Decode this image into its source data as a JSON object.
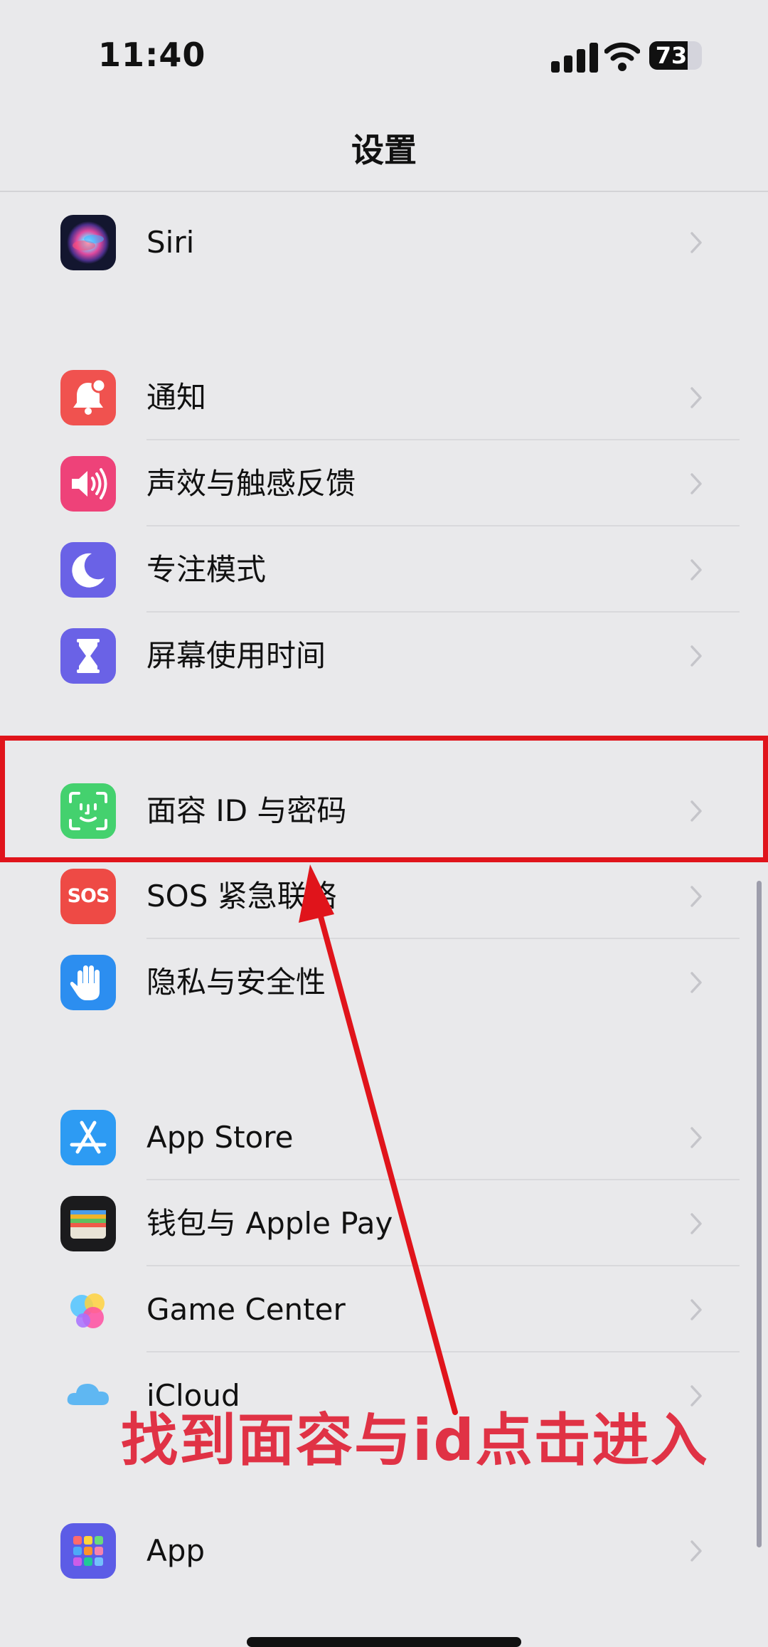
{
  "status_bar": {
    "time": "11:40",
    "battery_level": "73"
  },
  "nav": {
    "title": "设置"
  },
  "settings": {
    "siri": "Siri",
    "notifications": "通知",
    "sounds": "声效与触感反馈",
    "focus": "专注模式",
    "screen_time": "屏幕使用时间",
    "face_id": "面容 ID 与密码",
    "emergency_sos": "SOS 紧急联络",
    "sos_icon_text": "SOS",
    "privacy": "隐私与安全性",
    "app_store": "App Store",
    "wallet": "钱包与 Apple Pay",
    "game_center": "Game Center",
    "icloud": "iCloud",
    "apps": "App"
  },
  "annotation": {
    "text": "找到面容与id点击进入",
    "color": "#e03245"
  },
  "colors": {
    "background": "#e9e9eb",
    "highlight": "#e0141b",
    "notifications_icon": "#f0524f",
    "sounds_icon": "#ee4279",
    "focus_icon": "#6a62e6",
    "screen_time_icon": "#6a62e6",
    "face_id_icon": "#44d16e",
    "sos_icon": "#ee4a45",
    "privacy_icon": "#2c8ef0",
    "app_store_icon": "#2d9bf3",
    "wallet_icon": "#1b1b1d",
    "apps_icon": "#5c5ce6"
  }
}
